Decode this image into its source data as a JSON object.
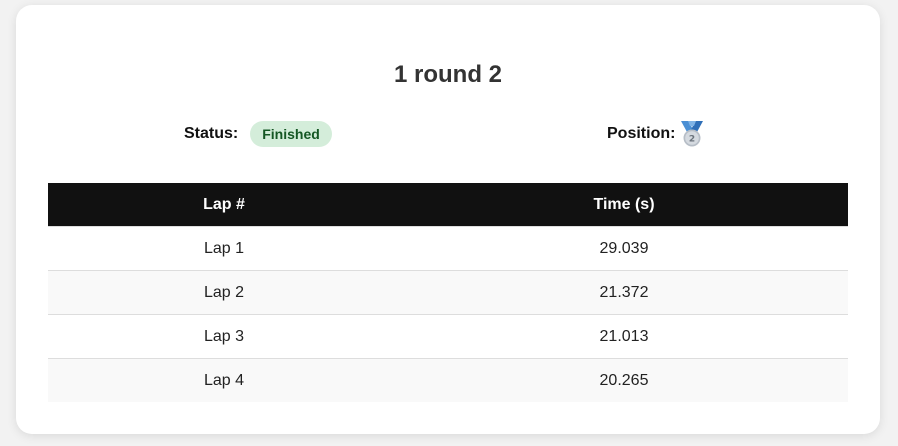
{
  "page": {
    "title": "1 round 2"
  },
  "status": {
    "label": "Status:",
    "value": "Finished",
    "badge_bg": "#d4edda",
    "badge_fg": "#155724"
  },
  "position": {
    "label": "Position:",
    "value": "2",
    "icon": "second-place-medal-icon"
  },
  "laps_table": {
    "headers": [
      "Lap #",
      "Time (s)"
    ],
    "rows": [
      {
        "lap": "Lap 1",
        "time": "29.039"
      },
      {
        "lap": "Lap 2",
        "time": "21.372"
      },
      {
        "lap": "Lap 3",
        "time": "21.013"
      },
      {
        "lap": "Lap 4",
        "time": "20.265"
      }
    ]
  }
}
